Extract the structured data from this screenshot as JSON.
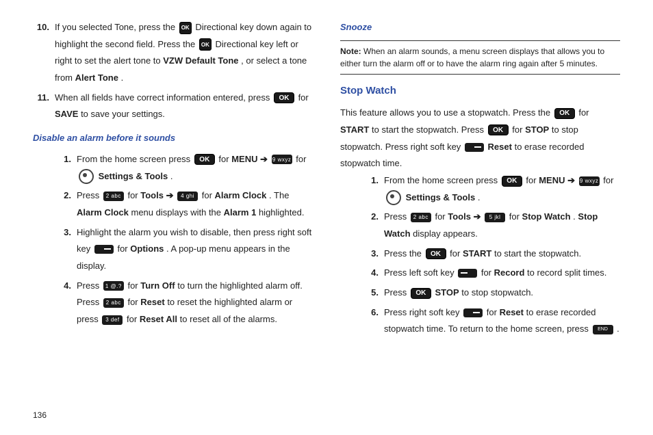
{
  "pageNumber": "136",
  "left": {
    "item10": {
      "n": "10.",
      "t1": "If you selected Tone, press the ",
      "t2": " Directional key down again to highlight the second field. Press the ",
      "t3": " Directional key left or right to set the alert tone to ",
      "b1": "VZW Default Tone",
      "t4": ", or select a tone from ",
      "b2": "Alert Tone",
      "t5": "."
    },
    "item11": {
      "n": "11.",
      "t1": "When all fields have correct information entered, press ",
      "t2": " for ",
      "b1": "SAVE",
      "t3": " to save your settings."
    },
    "sub1": "Disable an alarm before it sounds",
    "d1": {
      "n": "1.",
      "t1": "From the home screen press ",
      "t2": " for ",
      "b1": "MENU",
      "arrow": " ➔ ",
      "t3": " for ",
      "b2": "Settings & Tools",
      "t4": "."
    },
    "d2": {
      "n": "2.",
      "t1": "Press ",
      "t2": " for ",
      "b1": "Tools",
      "arrow": " ➔ ",
      "t3": " for ",
      "b2": "Alarm Clock",
      "t4": ". The ",
      "b3": "Alarm Clock",
      "t5": " menu displays with the ",
      "b4": "Alarm 1",
      "t6": " highlighted."
    },
    "d3": {
      "n": "3.",
      "t1": "Highlight the alarm you wish to disable, then press right soft key ",
      "t2": " for ",
      "b1": "Options",
      "t3": ". A pop-up menu appears in the display."
    },
    "d4": {
      "n": "4.",
      "t1": "Press ",
      "t2": " for ",
      "b1": "Turn Off",
      "t3": " to turn the highlighted alarm off. Press ",
      "t4": " for ",
      "b2": "Reset",
      "t5": " to reset the highlighted alarm or press ",
      "t6": " for ",
      "b3": "Reset All",
      "t7": " to reset all of the alarms."
    }
  },
  "right": {
    "sub1": "Snooze",
    "noteLabel": "Note:",
    "noteText": " When an alarm sounds, a menu screen displays that allows you to either turn the alarm off or to have the alarm ring again after 5 minutes.",
    "section": "Stop Watch",
    "intro": {
      "t1": "This feature allows you to use a stopwatch. Press the ",
      "t2": " for ",
      "b1": "START",
      "t3": " to start the stopwatch. Press ",
      "t4": " for ",
      "b2": "STOP",
      "t5": " to stop stopwatch. Press right soft key ",
      "b3": "Reset",
      "t6": " to erase recorded stopwatch time."
    },
    "s1": {
      "n": "1.",
      "t1": "From the home screen press ",
      "t2": " for ",
      "b1": "MENU",
      "arrow": " ➔ ",
      "t3": " for ",
      "b2": "Settings & Tools",
      "t4": "."
    },
    "s2": {
      "n": "2.",
      "t1": "Press ",
      "t2": " for ",
      "b1": "Tools",
      "arrow": " ➔ ",
      "t3": " for ",
      "b2": "Stop Watch",
      "t4": ". ",
      "b3": "Stop Watch",
      "t5": " display appears."
    },
    "s3": {
      "n": "3.",
      "t1": "Press the ",
      "t2": " for ",
      "b1": "START",
      "t3": " to start the stopwatch."
    },
    "s4": {
      "n": "4.",
      "t1": "Press left soft key ",
      "t2": " for ",
      "b1": "Record",
      "t3": " to record split times."
    },
    "s5": {
      "n": "5.",
      "t1": "Press ",
      "b1": "STOP",
      "t2": " to stop stopwatch."
    },
    "s6": {
      "n": "6.",
      "t1": "Press right soft key ",
      "t2": " for ",
      "b1": "Reset",
      "t3": " to erase recorded stopwatch time. To return to the home screen, press ",
      "t4": "."
    }
  },
  "keys": {
    "ok": "OK",
    "ok2": "OK",
    "k1": "1 @.?",
    "k2": "2 abc",
    "k3": "3 def",
    "k4": "4 ghi",
    "k5": "5 jkl",
    "k9": "9 wxyz",
    "end": "END"
  }
}
